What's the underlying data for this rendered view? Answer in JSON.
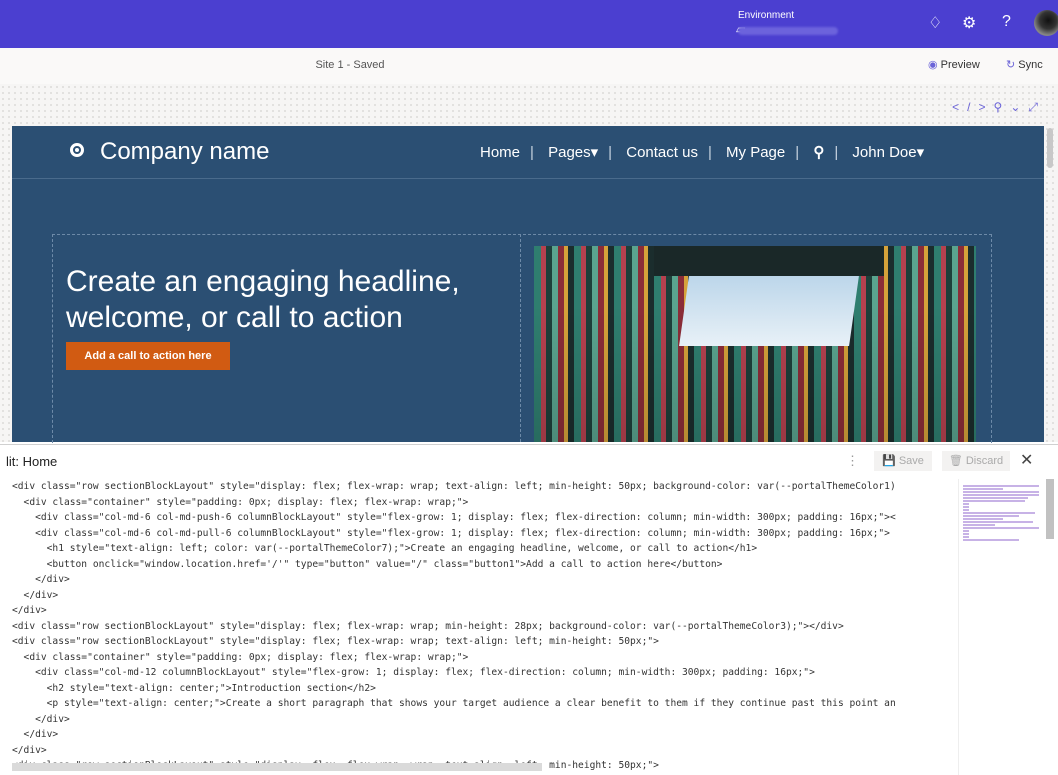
{
  "topbar": {
    "environment_label": "Environment",
    "icons": [
      "environment-icon",
      "bell-icon",
      "gear-icon",
      "help-icon"
    ],
    "help_symbol": "?"
  },
  "subbar": {
    "site_status": "Site 1 - Saved",
    "preview_label": "Preview",
    "sync_label": "Sync"
  },
  "site": {
    "company_name": "Company name",
    "nav": [
      "Home",
      "Pages▾",
      "Contact us",
      "My Page",
      "John Doe▾"
    ],
    "headline": "Create an engaging headline, welcome, or call to action",
    "cta_label": "Add a call to action here"
  },
  "editor": {
    "title": "lit: Home",
    "save_label": "Save",
    "discard_label": "Discard",
    "code_lines": [
      "<div class=\"row sectionBlockLayout\" style=\"display: flex; flex-wrap: wrap; text-align: left; min-height: 50px; background-color: var(--portalThemeColor1)",
      "  <div class=\"container\" style=\"padding: 0px; display: flex; flex-wrap: wrap;\">",
      "    <div class=\"col-md-6 col-md-push-6 columnBlockLayout\" style=\"flex-grow: 1; display: flex; flex-direction: column; min-width: 300px; padding: 16px;\"><",
      "    <div class=\"col-md-6 col-md-pull-6 columnBlockLayout\" style=\"flex-grow: 1; display: flex; flex-direction: column; min-width: 300px; padding: 16px;\">",
      "      <h1 style=\"text-align: left; color: var(--portalThemeColor7);\">Create an engaging headline, welcome, or call to action</h1>",
      "      <button onclick=\"window.location.href='/'\" type=\"button\" value=\"/\" class=\"button1\">Add a call to action here</button>",
      "    </div>",
      "  </div>",
      "</div>",
      "<div class=\"row sectionBlockLayout\" style=\"display: flex; flex-wrap: wrap; min-height: 28px; background-color: var(--portalThemeColor3);\"></div>",
      "<div class=\"row sectionBlockLayout\" style=\"display: flex; flex-wrap: wrap; text-align: left; min-height: 50px;\">",
      "  <div class=\"container\" style=\"padding: 0px; display: flex; flex-wrap: wrap;\">",
      "    <div class=\"col-md-12 columnBlockLayout\" style=\"flex-grow: 1; display: flex; flex-direction: column; min-width: 300px; padding: 16px;\">",
      "      <h2 style=\"text-align: center;\">Introduction section</h2>",
      "      <p style=\"text-align: center;\">Create a short paragraph that shows your target audience a clear benefit to them if they continue past this point an",
      "    </div>",
      "  </div>",
      "</div>",
      "<div class=\"row sectionBlockLayout\" style=\"display: flex; flex-wrap: wrap; text-align: left; min-height: 50px;\">"
    ]
  },
  "colors": {
    "topbar": "#4b3fd0",
    "site_bg": "#2b4f73",
    "cta": "#d15b12"
  }
}
